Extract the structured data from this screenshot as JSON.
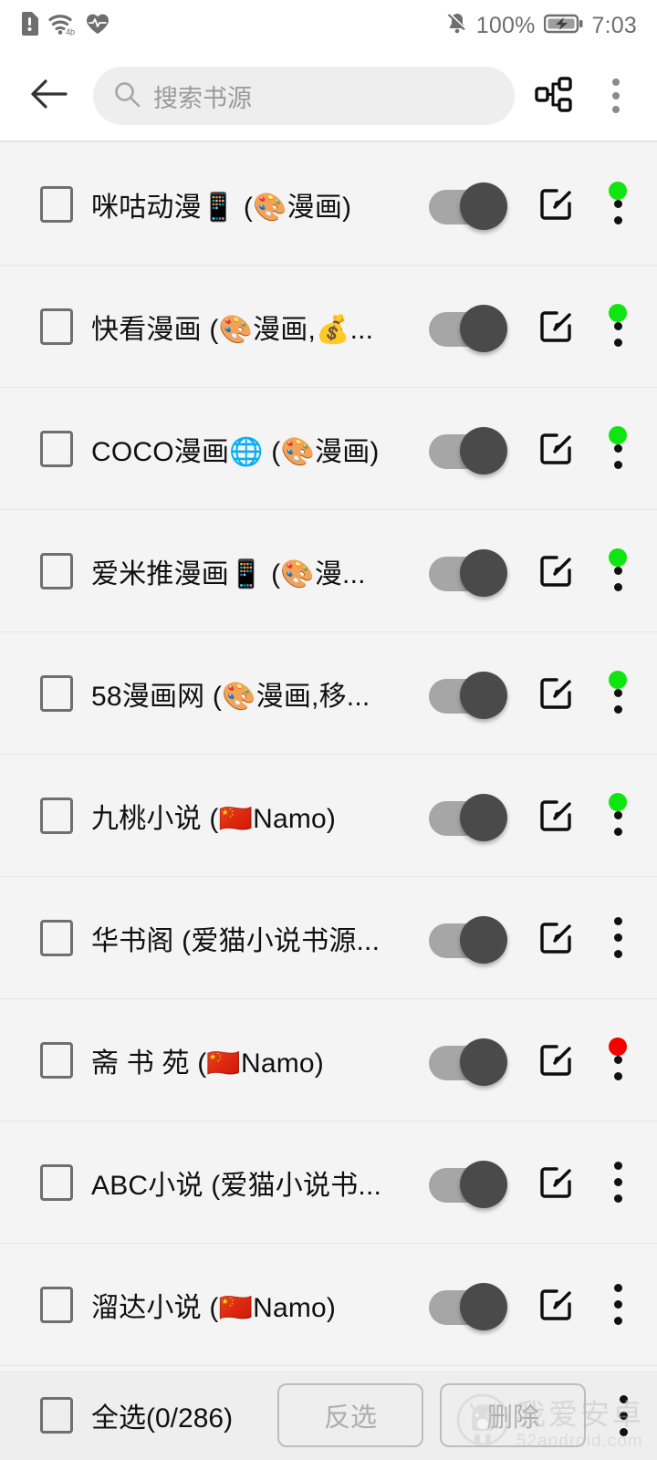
{
  "status_bar": {
    "left_icons": [
      "sd-card-alert-icon",
      "wifi-4g-icon",
      "heartbeat-icon"
    ],
    "mute_icon": "bell-muted-icon",
    "battery_percent": "100%",
    "battery_icon": "battery-charging-icon",
    "time": "7:03"
  },
  "toolbar": {
    "back_icon": "arrow-left-icon",
    "search_icon": "search-icon",
    "search_placeholder": "搜索书源",
    "search_value": "",
    "group_icon": "sitemap-group-icon",
    "overflow_icon": "more-vertical-icon"
  },
  "list": {
    "rows": [
      {
        "title": "咪咕动漫📱 (🎨漫画)",
        "checked": false,
        "enabled": true,
        "status": "green"
      },
      {
        "title": "快看漫画 (🎨漫画,💰...",
        "checked": false,
        "enabled": true,
        "status": "green"
      },
      {
        "title": "COCO漫画🌐 (🎨漫画)",
        "checked": false,
        "enabled": true,
        "status": "green"
      },
      {
        "title": "爱米推漫画📱 (🎨漫...",
        "checked": false,
        "enabled": true,
        "status": "green"
      },
      {
        "title": "58漫画网 (🎨漫画,移...",
        "checked": false,
        "enabled": true,
        "status": "green"
      },
      {
        "title": "九桃小说 (🇨🇳Namo)",
        "checked": false,
        "enabled": true,
        "status": "green"
      },
      {
        "title": "华书阁 (爱猫小说书源...",
        "checked": false,
        "enabled": true,
        "status": "none"
      },
      {
        "title": "斋 书 苑 (🇨🇳Namo)",
        "checked": false,
        "enabled": true,
        "status": "red"
      },
      {
        "title": "ABC小说 (爱猫小说书...",
        "checked": false,
        "enabled": true,
        "status": "none"
      },
      {
        "title": "溜达小说 (🇨🇳Namo)",
        "checked": false,
        "enabled": true,
        "status": "none"
      }
    ],
    "edit_icon": "edit-square-icon",
    "row_overflow_icon": "more-vertical-icon"
  },
  "bottom_bar": {
    "select_all_label": "全选(0/286)",
    "select_all_checked": false,
    "selected_count": 0,
    "total_count": 286,
    "invert_label": "反选",
    "delete_label": "删除",
    "invert_enabled": false,
    "delete_enabled": false,
    "overflow_icon": "more-vertical-icon"
  },
  "watermark": {
    "cn": "我爱安卓",
    "en": "52android.com",
    "icon": "android-robot-icon"
  },
  "colors": {
    "status_green": "#11e511",
    "status_red": "#f40000",
    "toggle_thumb": "#4a4a4a",
    "toggle_track": "#a6a6a6",
    "list_bg": "#f4f4f4",
    "toolbar_bg": "#ffffff",
    "search_bg": "#eeeeee"
  }
}
